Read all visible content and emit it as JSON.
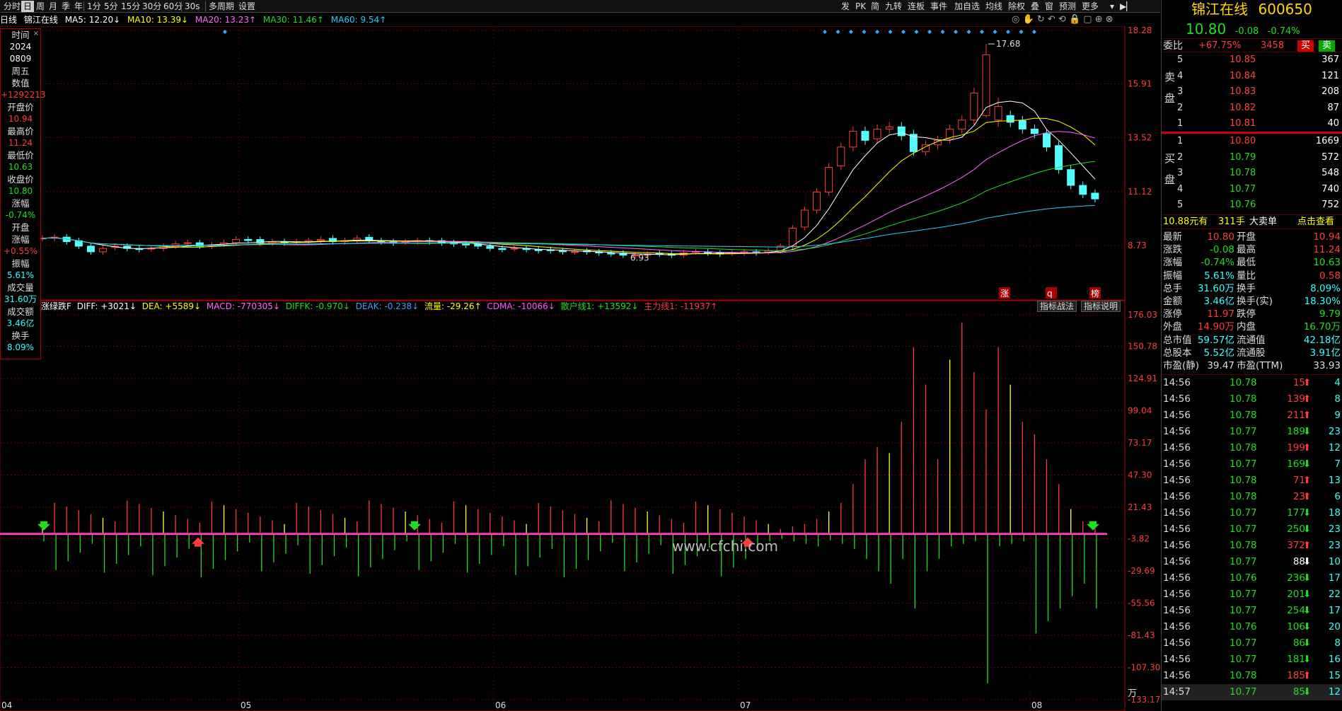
{
  "toolbar": {
    "items": [
      "分时",
      "日",
      "周",
      "月",
      "季",
      "年",
      "1分",
      "5分",
      "15分",
      "30分",
      "60分",
      "30s",
      "多周期",
      "设置"
    ],
    "right_items": [
      "发",
      "PK",
      "简",
      "九转",
      "连板",
      "事件",
      "加自选",
      "均线",
      "除权",
      "叠",
      "窗",
      "预测",
      "更多"
    ],
    "active": "日"
  },
  "title_bar": {
    "period": "日线",
    "name": "锦江在线",
    "ma5": "MA5: 12.20↓",
    "ma10": "MA10: 13.39↓",
    "ma20": "MA20: 13.23↑",
    "ma30": "MA30: 11.46↑",
    "ma60": "MA60: 9.54↑"
  },
  "info_box": [
    {
      "label": "时间",
      "value": "2024"
    },
    {
      "label": "",
      "value": "0809"
    },
    {
      "label": "周五",
      "value": ""
    },
    {
      "label": "数值",
      "value": "+1292213"
    },
    {
      "label": "开盘价",
      "value": "10.94"
    },
    {
      "label": "最高价",
      "value": "11.24"
    },
    {
      "label": "最低价",
      "value": "10.63"
    },
    {
      "label": "收盘价",
      "value": "10.80"
    },
    {
      "label": "涨幅",
      "value": "-0.74%"
    },
    {
      "label": "开盘",
      "value": ""
    },
    {
      "label": "涨幅",
      "value": "+0.55%"
    },
    {
      "label": "振幅",
      "value": "5.61%"
    },
    {
      "label": "成交量",
      "value": "31.60万"
    },
    {
      "label": "成交额",
      "value": "3.46亿"
    },
    {
      "label": "换手",
      "value": "8.09%"
    }
  ],
  "main_axis": [
    "18.28",
    "15.91",
    "13.52",
    "11.12",
    "8.73"
  ],
  "sub_axis": [
    "176.03",
    "150.78",
    "124.91",
    "99.04",
    "73.17",
    "47.30",
    "21.43",
    "-3.82",
    "-29.69",
    "-55.56",
    "-81.43",
    "-107.30",
    "-133.17"
  ],
  "sub_unit": "万",
  "date_labels": [
    "04",
    "05",
    "06",
    "07",
    "08"
  ],
  "price_annotations": {
    "high": "17.68",
    "low": "6.93"
  },
  "bottom_marks": [
    "涨",
    "q",
    "榜"
  ],
  "sub_indicator": {
    "name": "涨绿跌F",
    "diff": "DIFF: +3021↓",
    "dea": "DEA: +5589↓",
    "macd": "MACD: -770305↓",
    "diffk": "DIFFK: -0.970↓",
    "deak": "DEAK: -0.238↓",
    "flow": "流量: -29.26↑",
    "cdma": "CDMA: -10066↓",
    "retail": "散户线1: +13592↓",
    "main": "主力线1: -11937↑",
    "btn1": "指标战法",
    "btn2": "指标说明"
  },
  "watermark": "www.cfchi.com",
  "stock": {
    "name": "锦江在线",
    "code": "600650",
    "price": "10.80",
    "change": "-0.08",
    "pct": "-0.74%",
    "weibi_label": "委比",
    "weibi": "+67.75%",
    "weicha": "3458",
    "buy_btn": "买",
    "sell_btn": "卖",
    "sell_side": "卖盘",
    "buy_side": "买盘",
    "asks": [
      {
        "lv": "5",
        "p": "10.85",
        "v": "367"
      },
      {
        "lv": "4",
        "p": "10.84",
        "v": "121"
      },
      {
        "lv": "3",
        "p": "10.83",
        "v": "208"
      },
      {
        "lv": "2",
        "p": "10.82",
        "v": "87"
      },
      {
        "lv": "1",
        "p": "10.81",
        "v": "40"
      }
    ],
    "bids": [
      {
        "lv": "1",
        "p": "10.80",
        "v": "1669"
      },
      {
        "lv": "2",
        "p": "10.79",
        "v": "572"
      },
      {
        "lv": "3",
        "p": "10.78",
        "v": "548"
      },
      {
        "lv": "4",
        "p": "10.77",
        "v": "740"
      },
      {
        "lv": "5",
        "p": "10.76",
        "v": "752"
      }
    ],
    "big_order": {
      "price": "10.88元有",
      "qty": "311手",
      "label": "大卖单",
      "link": "点击查看"
    },
    "stats": [
      [
        "最新",
        "10.80",
        "开盘",
        "10.94"
      ],
      [
        "涨跌",
        "-0.08",
        "最高",
        "11.24"
      ],
      [
        "涨幅",
        "-0.74%",
        "最低",
        "10.63"
      ],
      [
        "振幅",
        "5.61%",
        "量比",
        "0.58"
      ],
      [
        "总手",
        "31.60万",
        "换手",
        "8.09%"
      ],
      [
        "金额",
        "3.46亿",
        "换手(实)",
        "18.30%"
      ],
      [
        "涨停",
        "11.97",
        "跌停",
        "9.79"
      ],
      [
        "外盘",
        "14.90万",
        "内盘",
        "16.70万"
      ],
      [
        "总市值",
        "59.57亿",
        "流通值",
        "42.18亿"
      ],
      [
        "总股本",
        "5.52亿",
        "流通股",
        "3.91亿"
      ],
      [
        "市盈(静)",
        "39.47",
        "市盈(TTM)",
        "33.93"
      ]
    ],
    "ticks": [
      [
        "14:56",
        "10.78",
        "15",
        "4"
      ],
      [
        "14:56",
        "10.78",
        "139",
        "8"
      ],
      [
        "14:56",
        "10.78",
        "211",
        "9"
      ],
      [
        "14:56",
        "10.77",
        "189",
        "23"
      ],
      [
        "14:56",
        "10.78",
        "199",
        "12"
      ],
      [
        "14:56",
        "10.77",
        "169",
        "7"
      ],
      [
        "14:56",
        "10.78",
        "71",
        "13"
      ],
      [
        "14:56",
        "10.78",
        "23",
        "6"
      ],
      [
        "14:56",
        "10.77",
        "177",
        "18"
      ],
      [
        "14:56",
        "10.77",
        "250",
        "23"
      ],
      [
        "14:56",
        "10.78",
        "372",
        "23"
      ],
      [
        "14:56",
        "10.77",
        "88",
        "10"
      ],
      [
        "14:56",
        "10.76",
        "236",
        "17"
      ],
      [
        "14:56",
        "10.77",
        "201",
        "22"
      ],
      [
        "14:56",
        "10.77",
        "254",
        "17"
      ],
      [
        "14:56",
        "10.76",
        "106",
        "20"
      ],
      [
        "14:56",
        "10.77",
        "86",
        "8"
      ],
      [
        "14:56",
        "10.77",
        "181",
        "16"
      ],
      [
        "14:56",
        "10.78",
        "185",
        "15"
      ],
      [
        "14:57",
        "10.77",
        "85",
        "12"
      ]
    ]
  }
}
